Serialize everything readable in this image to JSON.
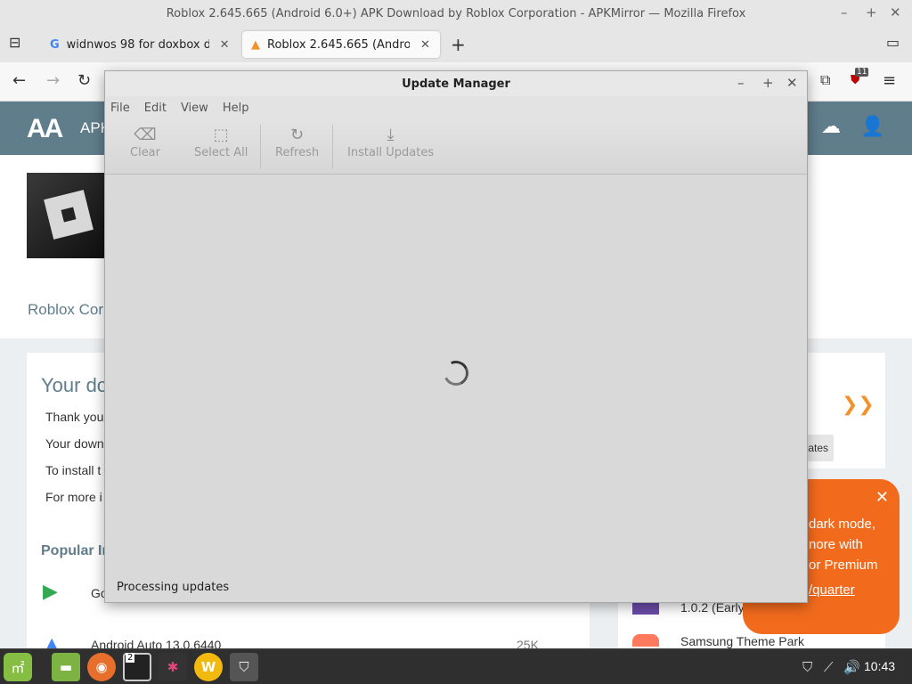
{
  "window": {
    "title": "Roblox 2.645.665 (Android 6.0+) APK Download by Roblox Corporation - APKMirror — Mozilla Firefox",
    "controls": {
      "minimize": "–",
      "maximize": "+",
      "close": "✕"
    }
  },
  "tabs": [
    {
      "label": "widnwos 98 for doxbox disk",
      "close": "✕"
    },
    {
      "label": "Roblox 2.645.665 (Android (",
      "close": "✕"
    }
  ],
  "newtab_label": "+",
  "extension_badge": "11",
  "page": {
    "header_logo": "AA",
    "header_logo_text": "APK",
    "developer": "Roblox Cor",
    "card_title": "Your do",
    "card_lines": [
      "Thank you",
      "Your down",
      "To install t",
      "For more i"
    ],
    "popular_title": "Popular In",
    "popular_items": [
      {
        "label": "Go",
        "count": ""
      },
      {
        "label": "Android Auto 13.0.6440",
        "count": "25K"
      }
    ],
    "updates_button": "ates",
    "right_list": [
      {
        "label": "1.0.2 (Early"
      },
      {
        "label": "Samsung Theme Park"
      }
    ],
    "promo": {
      "lines": [
        "dark mode,",
        "nore with",
        "or Premium"
      ],
      "link": "/quarter",
      "close": "✕"
    }
  },
  "dialog": {
    "title": "Update Manager",
    "controls": {
      "minimize": "–",
      "maximize": "+",
      "close": "✕"
    },
    "menu": [
      "File",
      "Edit",
      "View",
      "Help"
    ],
    "toolbar": {
      "clear": "Clear",
      "select_all": "Select All",
      "refresh": "Refresh",
      "install_updates": "Install Updates"
    },
    "status": "Processing updates"
  },
  "taskbar": {
    "terminal_badge": "2",
    "clock": "10:43"
  }
}
